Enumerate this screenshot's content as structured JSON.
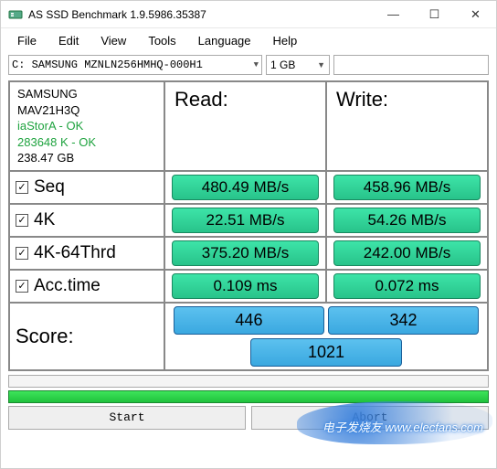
{
  "window": {
    "title": "AS SSD Benchmark 1.9.5986.35387"
  },
  "menu": {
    "file": "File",
    "edit": "Edit",
    "view": "View",
    "tools": "Tools",
    "language": "Language",
    "help": "Help"
  },
  "selectors": {
    "drive": "C: SAMSUNG MZNLN256HMHQ-000H1",
    "size": "1 GB"
  },
  "info": {
    "vendor": "SAMSUNG",
    "firmware": "MAV21H3Q",
    "driver": "iaStorA - OK",
    "alignment": "283648 K - OK",
    "capacity": "238.47 GB"
  },
  "headers": {
    "read": "Read:",
    "write": "Write:"
  },
  "rows": {
    "seq": {
      "label": "Seq",
      "read": "480.49 MB/s",
      "write": "458.96 MB/s"
    },
    "k4": {
      "label": "4K",
      "read": "22.51 MB/s",
      "write": "54.26 MB/s"
    },
    "k4t": {
      "label": "4K-64Thrd",
      "read": "375.20 MB/s",
      "write": "242.00 MB/s"
    },
    "acc": {
      "label": "Acc.time",
      "read": "0.109 ms",
      "write": "0.072 ms"
    }
  },
  "score": {
    "label": "Score:",
    "read": "446",
    "write": "342",
    "total": "1021"
  },
  "buttons": {
    "start": "Start",
    "abort": "Abort"
  },
  "watermark": "电子发烧友\nwww.elecfans.com"
}
